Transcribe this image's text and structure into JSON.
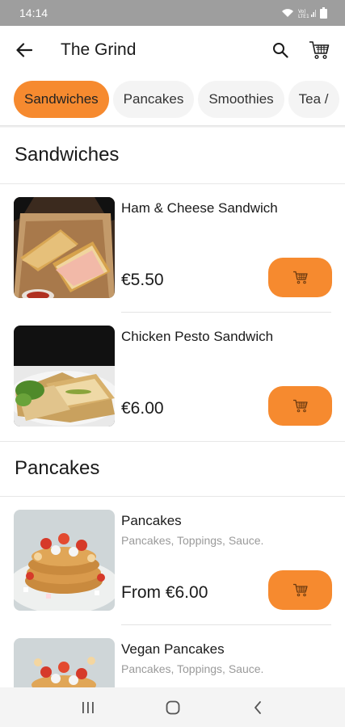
{
  "status": {
    "time": "14:14",
    "network": "Vo) LTE1 .ıl"
  },
  "app_bar": {
    "title": "The Grind"
  },
  "categories": [
    {
      "label": "Sandwiches",
      "active": true
    },
    {
      "label": "Pancakes",
      "active": false
    },
    {
      "label": "Smoothies",
      "active": false
    },
    {
      "label": "Tea /",
      "active": false
    }
  ],
  "sections": [
    {
      "title": "Sandwiches",
      "items": [
        {
          "name": "Ham & Cheese Sandwich",
          "description": "",
          "price": "€5.50",
          "image": "ham-cheese-sandwich-photo"
        },
        {
          "name": "Chicken Pesto Sandwich",
          "description": "",
          "price": "€6.00",
          "image": "chicken-pesto-sandwich-photo"
        }
      ]
    },
    {
      "title": "Pancakes",
      "items": [
        {
          "name": "Pancakes",
          "description": "Pancakes, Toppings, Sauce.",
          "price": "From €6.00",
          "image": "pancakes-photo"
        },
        {
          "name": "Vegan Pancakes",
          "description": "Pancakes, Toppings, Sauce.",
          "price": "",
          "image": "vegan-pancakes-photo"
        }
      ]
    }
  ],
  "colors": {
    "accent": "#f68a2f",
    "status_bar": "#9e9e9e",
    "nav_bar": "#f4f4f4"
  },
  "icons": [
    "back-arrow-icon",
    "search-icon",
    "cart-icon",
    "add-to-cart-icon",
    "recents-icon",
    "home-icon",
    "back-nav-icon"
  ]
}
